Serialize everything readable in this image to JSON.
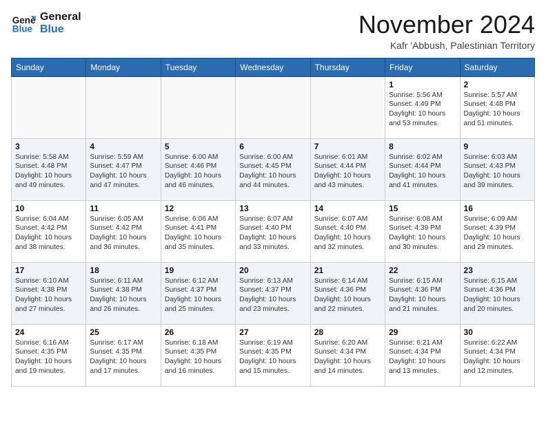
{
  "logo": {
    "line1": "General",
    "line2": "Blue"
  },
  "title": "November 2024",
  "location": "Kafr 'Abbush, Palestinian Territory",
  "weekdays": [
    "Sunday",
    "Monday",
    "Tuesday",
    "Wednesday",
    "Thursday",
    "Friday",
    "Saturday"
  ],
  "weeks": [
    [
      {
        "day": "",
        "info": ""
      },
      {
        "day": "",
        "info": ""
      },
      {
        "day": "",
        "info": ""
      },
      {
        "day": "",
        "info": ""
      },
      {
        "day": "",
        "info": ""
      },
      {
        "day": "1",
        "info": "Sunrise: 5:56 AM\nSunset: 4:49 PM\nDaylight: 10 hours\nand 53 minutes."
      },
      {
        "day": "2",
        "info": "Sunrise: 5:57 AM\nSunset: 4:48 PM\nDaylight: 10 hours\nand 51 minutes."
      }
    ],
    [
      {
        "day": "3",
        "info": "Sunrise: 5:58 AM\nSunset: 4:48 PM\nDaylight: 10 hours\nand 49 minutes."
      },
      {
        "day": "4",
        "info": "Sunrise: 5:59 AM\nSunset: 4:47 PM\nDaylight: 10 hours\nand 47 minutes."
      },
      {
        "day": "5",
        "info": "Sunrise: 6:00 AM\nSunset: 4:46 PM\nDaylight: 10 hours\nand 46 minutes."
      },
      {
        "day": "6",
        "info": "Sunrise: 6:00 AM\nSunset: 4:45 PM\nDaylight: 10 hours\nand 44 minutes."
      },
      {
        "day": "7",
        "info": "Sunrise: 6:01 AM\nSunset: 4:44 PM\nDaylight: 10 hours\nand 43 minutes."
      },
      {
        "day": "8",
        "info": "Sunrise: 6:02 AM\nSunset: 4:44 PM\nDaylight: 10 hours\nand 41 minutes."
      },
      {
        "day": "9",
        "info": "Sunrise: 6:03 AM\nSunset: 4:43 PM\nDaylight: 10 hours\nand 39 minutes."
      }
    ],
    [
      {
        "day": "10",
        "info": "Sunrise: 6:04 AM\nSunset: 4:42 PM\nDaylight: 10 hours\nand 38 minutes."
      },
      {
        "day": "11",
        "info": "Sunrise: 6:05 AM\nSunset: 4:42 PM\nDaylight: 10 hours\nand 36 minutes."
      },
      {
        "day": "12",
        "info": "Sunrise: 6:06 AM\nSunset: 4:41 PM\nDaylight: 10 hours\nand 35 minutes."
      },
      {
        "day": "13",
        "info": "Sunrise: 6:07 AM\nSunset: 4:40 PM\nDaylight: 10 hours\nand 33 minutes."
      },
      {
        "day": "14",
        "info": "Sunrise: 6:07 AM\nSunset: 4:40 PM\nDaylight: 10 hours\nand 32 minutes."
      },
      {
        "day": "15",
        "info": "Sunrise: 6:08 AM\nSunset: 4:39 PM\nDaylight: 10 hours\nand 30 minutes."
      },
      {
        "day": "16",
        "info": "Sunrise: 6:09 AM\nSunset: 4:39 PM\nDaylight: 10 hours\nand 29 minutes."
      }
    ],
    [
      {
        "day": "17",
        "info": "Sunrise: 6:10 AM\nSunset: 4:38 PM\nDaylight: 10 hours\nand 27 minutes."
      },
      {
        "day": "18",
        "info": "Sunrise: 6:11 AM\nSunset: 4:38 PM\nDaylight: 10 hours\nand 26 minutes."
      },
      {
        "day": "19",
        "info": "Sunrise: 6:12 AM\nSunset: 4:37 PM\nDaylight: 10 hours\nand 25 minutes."
      },
      {
        "day": "20",
        "info": "Sunrise: 6:13 AM\nSunset: 4:37 PM\nDaylight: 10 hours\nand 23 minutes."
      },
      {
        "day": "21",
        "info": "Sunrise: 6:14 AM\nSunset: 4:36 PM\nDaylight: 10 hours\nand 22 minutes."
      },
      {
        "day": "22",
        "info": "Sunrise: 6:15 AM\nSunset: 4:36 PM\nDaylight: 10 hours\nand 21 minutes."
      },
      {
        "day": "23",
        "info": "Sunrise: 6:15 AM\nSunset: 4:36 PM\nDaylight: 10 hours\nand 20 minutes."
      }
    ],
    [
      {
        "day": "24",
        "info": "Sunrise: 6:16 AM\nSunset: 4:35 PM\nDaylight: 10 hours\nand 19 minutes."
      },
      {
        "day": "25",
        "info": "Sunrise: 6:17 AM\nSunset: 4:35 PM\nDaylight: 10 hours\nand 17 minutes."
      },
      {
        "day": "26",
        "info": "Sunrise: 6:18 AM\nSunset: 4:35 PM\nDaylight: 10 hours\nand 16 minutes."
      },
      {
        "day": "27",
        "info": "Sunrise: 6:19 AM\nSunset: 4:35 PM\nDaylight: 10 hours\nand 15 minutes."
      },
      {
        "day": "28",
        "info": "Sunrise: 6:20 AM\nSunset: 4:34 PM\nDaylight: 10 hours\nand 14 minutes."
      },
      {
        "day": "29",
        "info": "Sunrise: 6:21 AM\nSunset: 4:34 PM\nDaylight: 10 hours\nand 13 minutes."
      },
      {
        "day": "30",
        "info": "Sunrise: 6:22 AM\nSunset: 4:34 PM\nDaylight: 10 hours\nand 12 minutes."
      }
    ]
  ]
}
